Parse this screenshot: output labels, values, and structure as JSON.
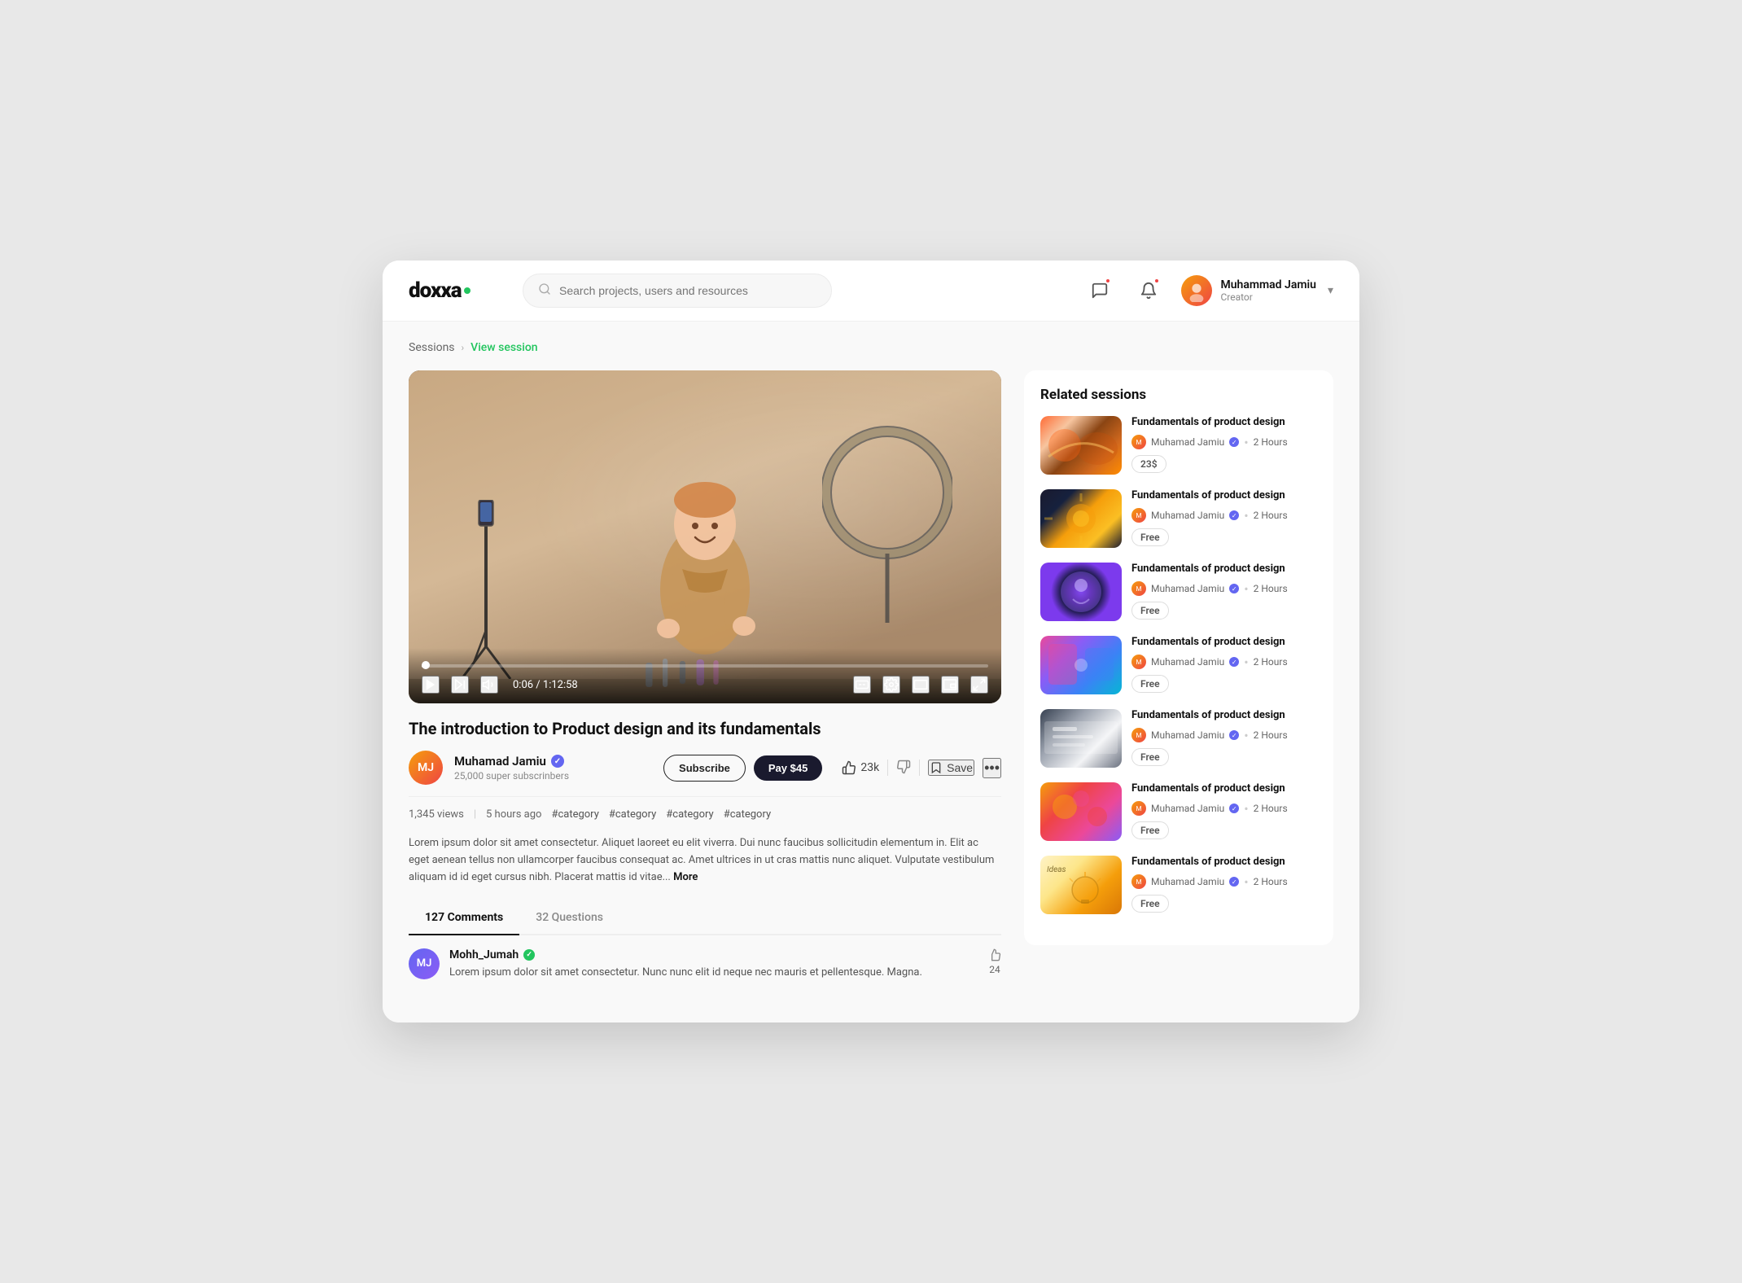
{
  "brand": {
    "name": "DOXXA",
    "logo_text": "doxxa"
  },
  "header": {
    "search_placeholder": "Search projects, users and resources",
    "user": {
      "name": "Muhammad Jamiu",
      "role": "Creator"
    }
  },
  "breadcrumb": {
    "parent": "Sessions",
    "current": "View session"
  },
  "video": {
    "title": "The introduction to Product design and its fundamentals",
    "time_current": "0:06",
    "time_total": "1:12:58",
    "creator": {
      "name": "Muhamad Jamiu",
      "subscribers": "25,000 super subscrinbers"
    },
    "subscribe_label": "Subscribe",
    "pay_label": "Pay $45",
    "likes": "23k",
    "save_label": "Save",
    "views": "1,345 views",
    "time_ago": "5 hours ago",
    "hashtags": [
      "#category",
      "#category",
      "#category",
      "#category"
    ],
    "description": "Lorem ipsum dolor sit amet consectetur. Aliquet laoreet eu elit viverra. Dui nunc faucibus sollicitudin elementum in. Elit ac eget aenean tellus non ullamcorper faucibus consequat ac. Amet ultrices in ut cras mattis nunc aliquet. Vulputate vestibulum aliquam id id eget cursus nibh. Placerat mattis id vitae...",
    "more_label": "More"
  },
  "tabs": [
    {
      "label": "127 Comments",
      "active": true
    },
    {
      "label": "32 Questions",
      "active": false
    }
  ],
  "comments": [
    {
      "author": "Mohh_Jumah",
      "verified": true,
      "text": "Lorem ipsum dolor sit amet consectetur. Nunc nunc elit id neque nec mauris et pellentesque. Magna.",
      "likes": 24
    }
  ],
  "related_sessions": {
    "title": "Related sessions",
    "items": [
      {
        "title": "Fundamentals of product design",
        "author": "Muhamad Jamiu",
        "duration": "2 Hours",
        "price": "23$",
        "price_type": "paid",
        "thumb_class": "thumb-1"
      },
      {
        "title": "Fundamentals of product design",
        "author": "Muhamad Jamiu",
        "duration": "2 Hours",
        "price": "Free",
        "price_type": "free",
        "thumb_class": "thumb-2"
      },
      {
        "title": "Fundamentals of product design",
        "author": "Muhamad Jamiu",
        "duration": "2 Hours",
        "price": "Free",
        "price_type": "free",
        "thumb_class": "thumb-3"
      },
      {
        "title": "Fundamentals of product design",
        "author": "Muhamad Jamiu",
        "duration": "2 Hours",
        "price": "Free",
        "price_type": "free",
        "thumb_class": "thumb-4"
      },
      {
        "title": "Fundamentals of product design",
        "author": "Muhamad Jamiu",
        "duration": "2 Hours",
        "price": "Free",
        "price_type": "free",
        "thumb_class": "thumb-5"
      },
      {
        "title": "Fundamentals of product design",
        "author": "Muhamad Jamiu",
        "duration": "2 Hours",
        "price": "Free",
        "price_type": "free",
        "thumb_class": "thumb-6"
      },
      {
        "title": "Fundamentals of product design",
        "author": "Muhamad Jamiu",
        "duration": "2 Hours",
        "price": "Free",
        "price_type": "free",
        "thumb_class": "thumb-7"
      }
    ]
  }
}
